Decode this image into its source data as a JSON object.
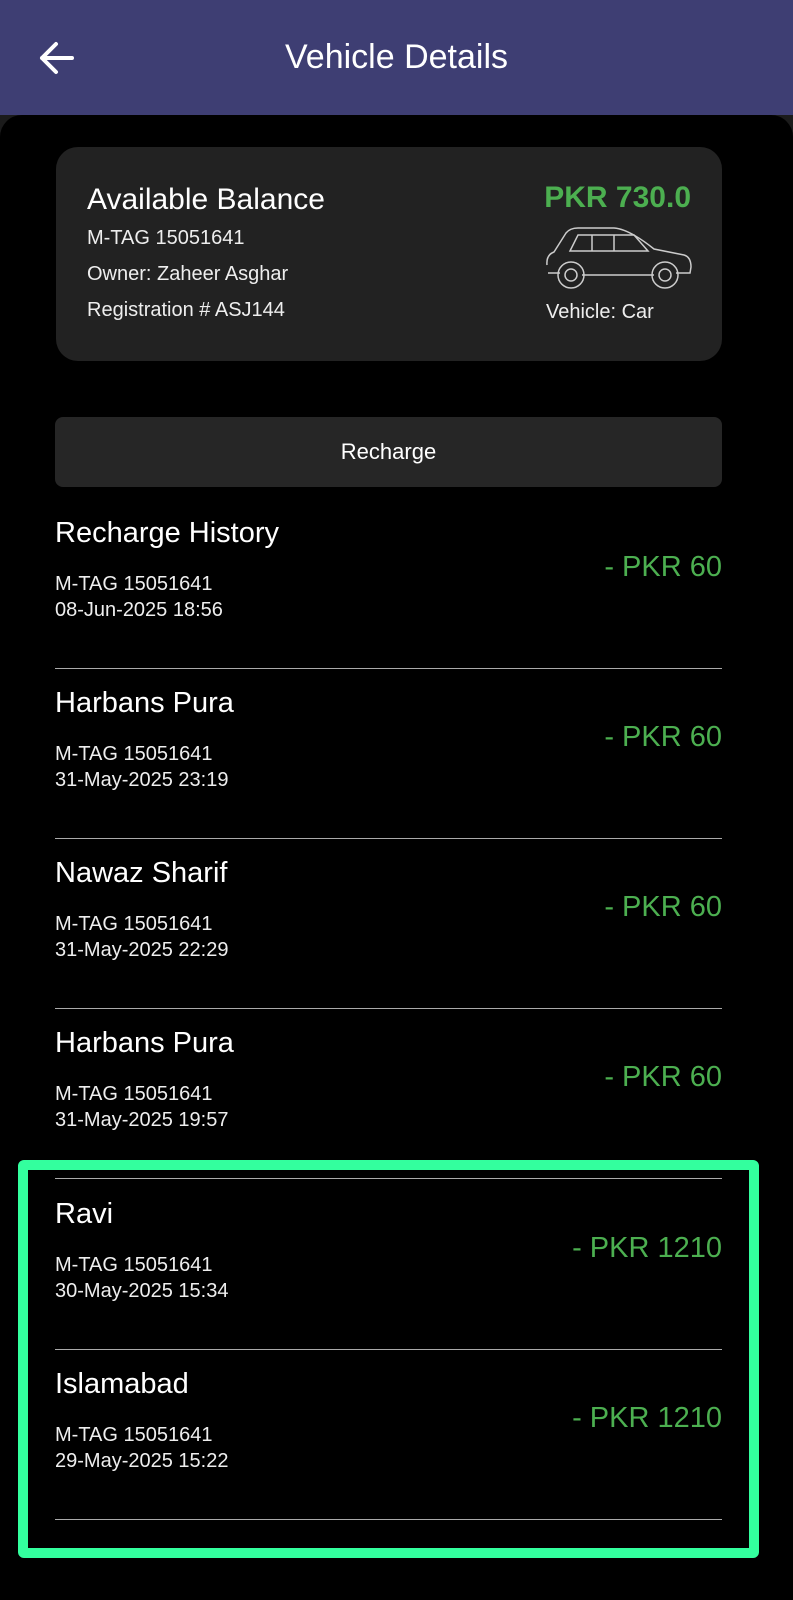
{
  "header": {
    "title": "Vehicle Details",
    "back_icon": "arrow-left-icon"
  },
  "balance_card": {
    "label": "Available Balance",
    "tag": "M-TAG 15051641",
    "owner": "Owner: Zaheer Asghar",
    "registration": "Registration # ASJ144",
    "balance": "PKR 730.0",
    "vehicle_icon": "car-icon",
    "vehicle_type": "Vehicle: Car"
  },
  "recharge_button": "Recharge",
  "transactions": [
    {
      "title": "Recharge History",
      "tag": "M-TAG 15051641",
      "datetime": "08-Jun-2025 18:56",
      "amount": "- PKR 60"
    },
    {
      "title": "Harbans Pura",
      "tag": "M-TAG 15051641",
      "datetime": "31-May-2025 23:19",
      "amount": "- PKR 60"
    },
    {
      "title": "Nawaz Sharif",
      "tag": "M-TAG 15051641",
      "datetime": "31-May-2025 22:29",
      "amount": "- PKR 60"
    },
    {
      "title": "Harbans Pura",
      "tag": "M-TAG 15051641",
      "datetime": "31-May-2025 19:57",
      "amount": "- PKR 60"
    },
    {
      "title": "Ravi",
      "tag": "M-TAG 15051641",
      "datetime": "30-May-2025 15:34",
      "amount": "- PKR 1210"
    },
    {
      "title": "Islamabad",
      "tag": "M-TAG 15051641",
      "datetime": "29-May-2025 15:22",
      "amount": "- PKR 1210"
    }
  ],
  "colors": {
    "header": "#3e3e73",
    "amount": "#4caf50",
    "highlight": "#33ff9e"
  }
}
